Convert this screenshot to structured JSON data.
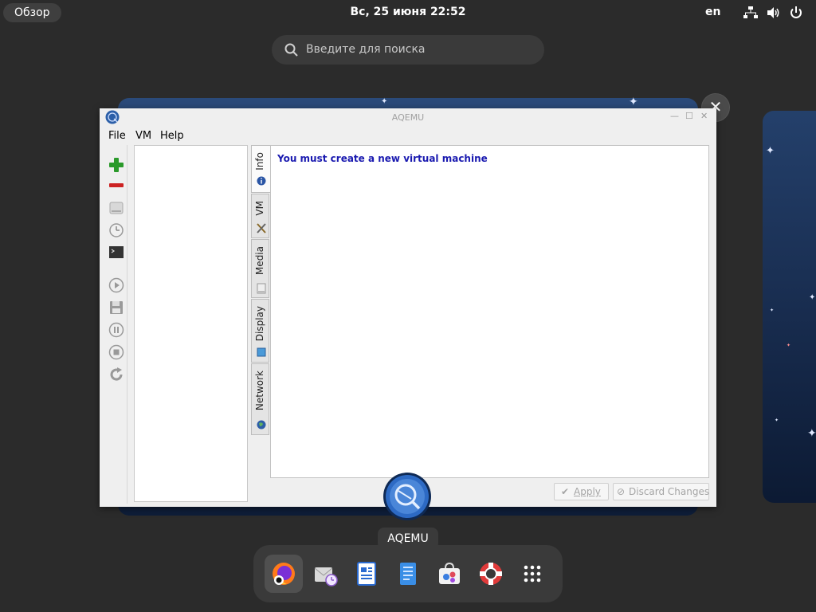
{
  "topbar": {
    "overview_label": "Обзор",
    "clock": "Вс, 25 июня  22:52",
    "language": "en",
    "tray_icons": [
      "network-icon",
      "volume-icon",
      "power-icon"
    ]
  },
  "search": {
    "placeholder": "Введите для поиска"
  },
  "window": {
    "title": "AQEMU",
    "menu": [
      {
        "label": "File"
      },
      {
        "label": "VM"
      },
      {
        "label": "Help"
      }
    ],
    "toolbar_icons": [
      "add-vm-icon",
      "remove-vm-icon",
      "vm-disk-icon",
      "clock-icon",
      "terminal-icon",
      "play-icon",
      "save-icon",
      "pause-icon",
      "stop-icon",
      "reset-icon"
    ],
    "tabs": [
      {
        "label": "Info",
        "icon": "info-icon",
        "active": true
      },
      {
        "label": "VM",
        "icon": "tools-icon",
        "active": false
      },
      {
        "label": "Media",
        "icon": "media-icon",
        "active": false
      },
      {
        "label": "Display",
        "icon": "display-icon",
        "active": false
      },
      {
        "label": "Network",
        "icon": "network-globe-icon",
        "active": false
      }
    ],
    "info_message": "You must create a new virtual machine",
    "apply_label": "Apply",
    "discard_label": "Discard Changes"
  },
  "app_tooltip": "AQEMU",
  "dock": {
    "items": [
      "firefox-icon",
      "evolution-icon",
      "writer-icon",
      "notes-icon",
      "software-icon",
      "help-icon",
      "app-grid-icon"
    ]
  },
  "colors": {
    "accent_text": "#1a1ab0",
    "panel_bg": "#2b2b2b"
  }
}
